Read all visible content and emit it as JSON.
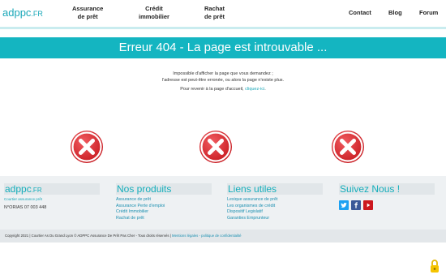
{
  "header": {
    "logo_main": "adppc",
    "logo_tld": ".FR",
    "nav_left": [
      {
        "line1": "Assurance",
        "line2": "de prêt"
      },
      {
        "line1": "Crédit",
        "line2": "immobilier"
      },
      {
        "line1": "Rachat",
        "line2": "de prêt"
      }
    ],
    "nav_right": [
      "Contact",
      "Blog",
      "Forum"
    ]
  },
  "banner": {
    "title": "Erreur 404 - La page est introuvable ..."
  },
  "message": {
    "line1": "Impossible d'afficher la page que vous demandez ;",
    "line2": "l'adresse est peut-être erronée, ou alors la page n'existe plus.",
    "back_prefix": "Pour revenir à la page d'accueil, ",
    "back_link": "cliquez-ici",
    "back_suffix": "."
  },
  "footer": {
    "brand": {
      "title_main": "adppc",
      "title_tld": ".FR",
      "subtitle": "Courtier assurance prêt",
      "orias": "N°ORIAS 07 003 448"
    },
    "products": {
      "title": "Nos produits",
      "links": [
        "Assurance de prêt",
        "Assurance Perte d'emploi",
        "Crédit Immobilier",
        "Rachat de prêt"
      ]
    },
    "useful": {
      "title": "Liens utiles",
      "links": [
        "Lexique assurance de prêt",
        "Les organismes de crédit",
        "Dispositif Legislatif",
        "Garanties Emprunteur"
      ]
    },
    "follow": {
      "title": "Suivez Nous !",
      "icons": [
        "twitter-icon",
        "facebook-icon",
        "youtube-icon"
      ]
    }
  },
  "copyright": {
    "text": "Copyright 2021 | Courtier As Du Grand Lyon © ADPPC Assurance De Prêt Pas Cher - Tous droits réservés | ",
    "link": "Mentions légales - politique de confidentialité"
  },
  "colors": {
    "accent": "#14b5c1",
    "error_red": "#d9262b"
  }
}
